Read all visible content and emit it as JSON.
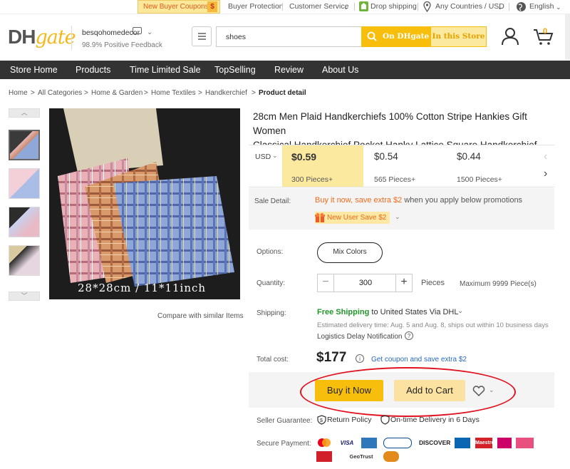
{
  "topbar": {
    "coupon": "New Buyer Coupons!",
    "coupon_icon": "$",
    "protection": "Buyer Protection",
    "service": "Customer Service",
    "drop": "Drop shipping",
    "country": "Any Countries / USD",
    "language": "English"
  },
  "header": {
    "logo_dh": "DH",
    "logo_gate": "gate",
    "store_name": "besqohomedecor",
    "feedback": "98.9% Positive Feedback",
    "search_value": "shoes",
    "search_dhgate": "On DHgate",
    "search_store": "In this Store",
    "cart_count": "0"
  },
  "nav": [
    "Store Home",
    "Products",
    "Time Limited Sale",
    "TopSelling",
    "Review",
    "About Us"
  ],
  "breadcrumb": [
    "Home",
    "All Categories",
    "Home & Garden",
    "Home Textiles",
    "Handkerchief",
    "Product detail"
  ],
  "gallery": {
    "image_caption": "28*28cm / 11*11inch",
    "compare": "Compare with similar Items"
  },
  "product": {
    "title_line1": "28cm Men Plaid Handkerchiefs 100% Cotton Stripe Hankies Gift Women",
    "title_line2": "Classical Handkerchief Pocket Hanky Lattice Square Handkerchief BC...",
    "currency": "USD",
    "tiers": [
      {
        "price": "$0.59",
        "qty": "300 Pieces+"
      },
      {
        "price": "$0.54",
        "qty": "565 Pieces+"
      },
      {
        "price": "$0.44",
        "qty": "1500 Pieces+"
      }
    ],
    "sale_label": "Sale Detail:",
    "sale_highlight": "Buy it now, save extra $2",
    "sale_rest": " when you apply below promotions",
    "new_user": "New User Save $2",
    "options_label": "Options:",
    "option_value": "Mix Colors",
    "qty_label": "Quantity:",
    "qty_value": "300",
    "qty_unit": "Pieces",
    "qty_max": "Maximum 9999 Piece(s)",
    "ship_label": "Shipping:",
    "free_ship": "Free Shipping",
    "ship_to": " to ",
    "ship_dest": "United States Via DHL",
    "delivery": "Estimated delivery time: Aug. 5 and Aug. 8, ships out within 10 business days",
    "logistics": "Logistics Delay Notification",
    "total_label": "Total cost:",
    "total": "$177",
    "coupon_link": "Get coupon and save extra $2",
    "buy_now": "Buy it Now",
    "add_cart": "Add to Cart",
    "guarantee_label": "Seller Guarantee:",
    "return_policy": "Return Policy",
    "ontime": "On-time Delivery in 6 Days",
    "payment_label": "Secure Payment:",
    "payments": [
      "VISA",
      "DISCOVER",
      "Maestro",
      "GeoTrust"
    ]
  },
  "colors": {
    "accent": "#f7bf0c",
    "nav": "#333333",
    "annotation": "#e0121f",
    "free_ship": "#22962a"
  }
}
